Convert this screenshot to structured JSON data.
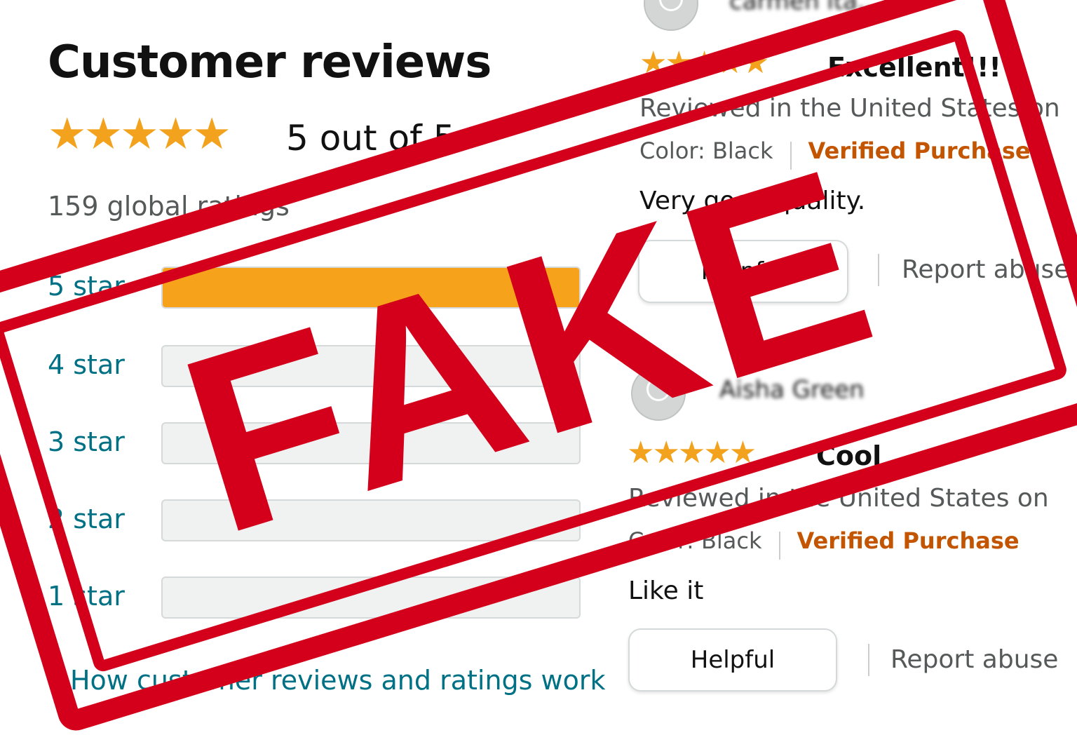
{
  "summary": {
    "title": "Customer reviews",
    "stars_glyph": "★★★★★",
    "rating_value": 5,
    "rating_text": "5 out of 5",
    "global_ratings": "159 global ratings"
  },
  "histogram": [
    {
      "label": "5 star",
      "percent": 100
    },
    {
      "label": "4 star",
      "percent": 0
    },
    {
      "label": "3 star",
      "percent": 0
    },
    {
      "label": "2 star",
      "percent": 0
    },
    {
      "label": "1 star",
      "percent": 0
    }
  ],
  "more_link": "How customer reviews and ratings work",
  "reviews": [
    {
      "reviewer": "carmen ita...",
      "stars_glyph": "★★★★★",
      "rating": 5,
      "title": "Excellent!!!",
      "meta": "Reviewed in the United States on",
      "color": "Color: Black",
      "verified": "Verified Purchase",
      "body": "Very good quality.",
      "helpful": "Helpful",
      "report": "Report abuse"
    },
    {
      "reviewer": "Aisha Green",
      "stars_glyph": "★★★★★",
      "rating": 5,
      "title": "Cool",
      "meta": "Reviewed in the United States on",
      "color": "Color: Black",
      "verified": "Verified Purchase",
      "body": "Like it",
      "helpful": "Helpful",
      "report": "Report abuse"
    }
  ],
  "stamp": {
    "text": "FAKE",
    "color": "#d4001b"
  },
  "colors": {
    "star": "#f3a21d",
    "bar_fill": "#f7a21b",
    "link": "#007185",
    "verified": "#c45500"
  }
}
